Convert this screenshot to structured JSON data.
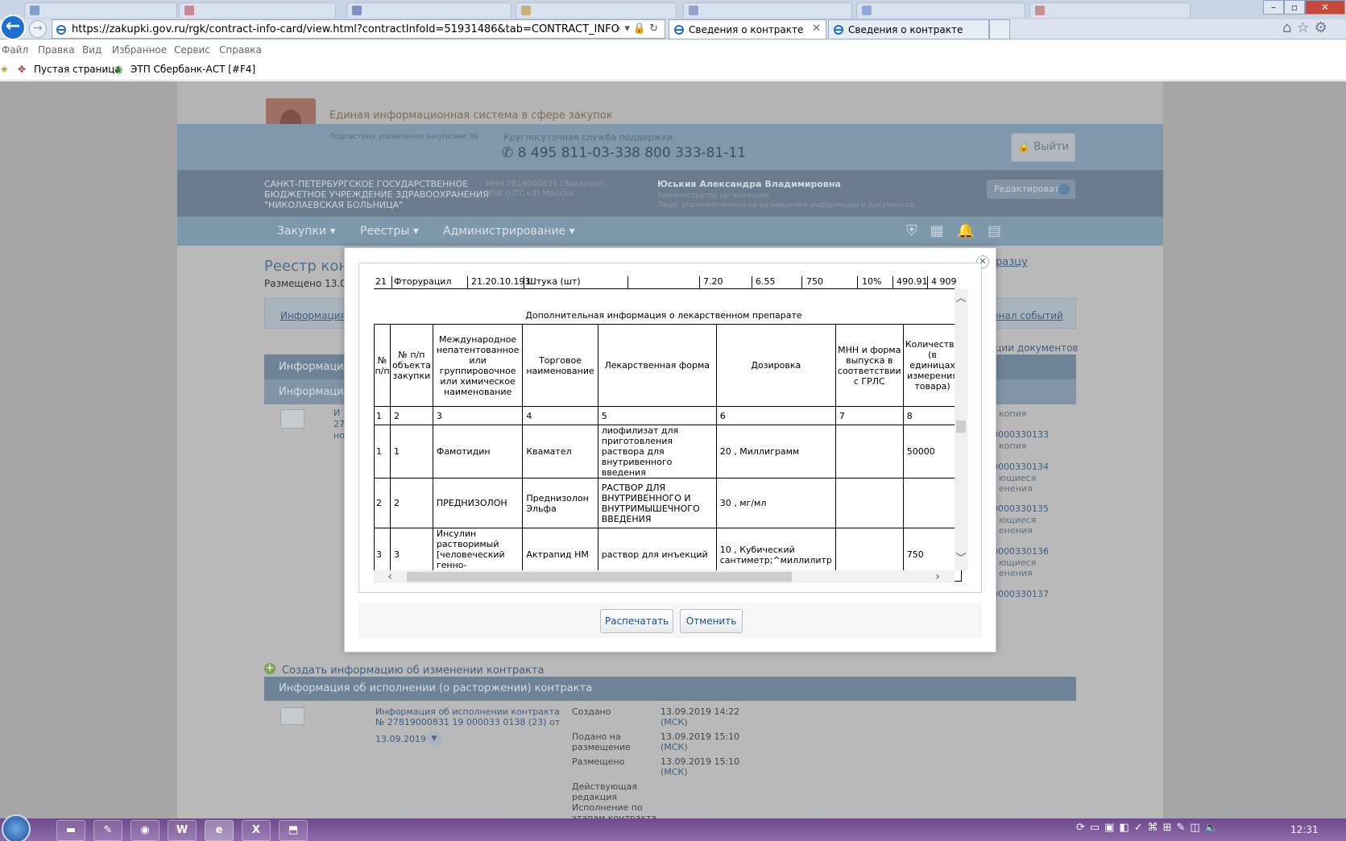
{
  "browser": {
    "url": "https://zakupki.gov.ru/rgk/contract-info-card/view.html?contractInfoId=51931486&tab=CONTRACT_INFO_CARD_DOCUMEN",
    "tab_active": "Сведения о контракте",
    "tab_second": "Сведения о контракте",
    "menu": [
      "Файл",
      "Правка",
      "Вид",
      "Избранное",
      "Сервис",
      "Справка"
    ],
    "favorites": [
      "Пустая страница",
      "ЭТП Сбербанк-АСТ [#F4]"
    ]
  },
  "header": {
    "system_title": "Единая информационная система в сфере закупок",
    "subsystem": "Подсистема управления закупками ЭБ",
    "support_label": "Круглосуточная служба поддержки:",
    "phone1": "8 495 811-03-33",
    "phone2": "8 800 333-81-11",
    "logout": "Выйти",
    "org_name": [
      "САНКТ-ПЕТЕРБУРГСКОЕ ГОСУДАРСТВЕННОЕ",
      "БЮДЖЕТНОЕ УЧРЕЖДЕНИЕ ЗДРАВООХРАНЕНИЯ",
      "\"НИКОЛАЕВСКАЯ БОЛЬНИЦА\""
    ],
    "inn": [
      "ИНН 7819000831 (Заказчик)",
      "MSK (UTC+3) Москва"
    ],
    "user_name": "Юськив Александра Владимировна",
    "user_role": [
      "Администратор организации",
      "Лицо, уполномоченное на размещение информации и документов"
    ],
    "edit_button": "Редактировать",
    "nav": [
      "Закупки",
      "Реестры",
      "Администрирование"
    ]
  },
  "page": {
    "registry_title": "Реестр конт",
    "placed": "Размещено 13.09",
    "tab_info": "Информация о",
    "link_sample": "бразцу",
    "link_journal": "рнал событий",
    "link_docs": "кции документов",
    "section1": "Информация о",
    "section2": "Информация о",
    "left_fragments": [
      "И",
      "27",
      "но"
    ],
    "right_items": [
      {
        "num": "",
        "sub": [
          "копия"
        ]
      },
      {
        "num": "0000330133",
        "sub": [
          "копия"
        ]
      },
      {
        "num": "0000330134",
        "sub": [
          "ющиеся",
          "енения"
        ]
      },
      {
        "num": "0000330135",
        "sub": [
          "ющиеся",
          "енения"
        ]
      },
      {
        "num": "0000330136",
        "sub": [
          "ющиеся",
          "енения"
        ]
      },
      {
        "num": "0000330137",
        "sub": []
      }
    ],
    "create_change": "Создать информацию об изменении контракта",
    "section3": "Информация об исполнении (о расторжении) контракта",
    "exec_link": [
      "Информация об исполнении контракта",
      "№ 27819000831 19 000033 0138 (23) от"
    ],
    "exec_date": "13.09.2019",
    "details": [
      {
        "label": [
          "Создано"
        ],
        "value": [
          "13.09.2019 14:22",
          "(МСК)"
        ]
      },
      {
        "label": [
          "Подано на",
          "размещение"
        ],
        "value": [
          "13.09.2019 15:10",
          "(МСК)"
        ]
      },
      {
        "label": [
          "Размещено"
        ],
        "value": [
          "13.09.2019 15:10",
          "(МСК)"
        ]
      },
      {
        "label": [
          "Действующая",
          "редакция",
          "Исполнение по",
          "этапам контракта"
        ],
        "value": []
      }
    ]
  },
  "modal": {
    "row_above": [
      "21",
      "Фторурацил",
      "21.20.10.193",
      "Штука (шт)",
      "",
      "7.20",
      "6.55",
      "750",
      "10%",
      "490.91",
      "4 909"
    ],
    "section_title": "Дополнительная информация о лекарственном препарате",
    "headers": [
      "№ п/п",
      "№ п/п объекта закупки",
      "Международное непатентованное или группировочное или химическое наименование",
      "Торговое наименование",
      "Лекарственная форма",
      "Дозировка",
      "МНН и форма выпуска в соответствии с ГРЛС",
      "Количество (в единицах измерения товара)"
    ],
    "col_numbers": [
      "1",
      "2",
      "3",
      "4",
      "5",
      "6",
      "7",
      "8"
    ],
    "rows": [
      [
        "1",
        "1",
        "Фамотидин",
        "Квамател",
        "лиофилизат для приготовления раствора для внутривенного введения",
        "20 , Миллиграмм",
        "",
        "50000"
      ],
      [
        "2",
        "2",
        "ПРЕДНИЗОЛОН",
        "Преднизолон Эльфа",
        "РАСТВОР ДЛЯ ВНУТРИВЕННОГО И ВНУТРИМЫШЕЧНОГО ВВЕДЕНИЯ",
        "30 , мг/мл",
        "",
        ""
      ],
      [
        "3",
        "3",
        "Инсулин растворимый [человеческий генно-инженерный]",
        "Актрапид НМ",
        "раствор для инъекций",
        "10 , Кубический сантиметр;^миллилитр",
        "",
        "750"
      ]
    ],
    "print_button": "Распечатать",
    "cancel_button": "Отменить"
  },
  "taskbar": {
    "apps": [
      "folder",
      "paint",
      "chrome",
      "W",
      "ie",
      "X",
      "pdf"
    ],
    "clock": "12:31"
  },
  "colors": {
    "accent": "#1f4e84",
    "header_blue": "#7f98ac",
    "org_bar": "#6b7c8e"
  }
}
